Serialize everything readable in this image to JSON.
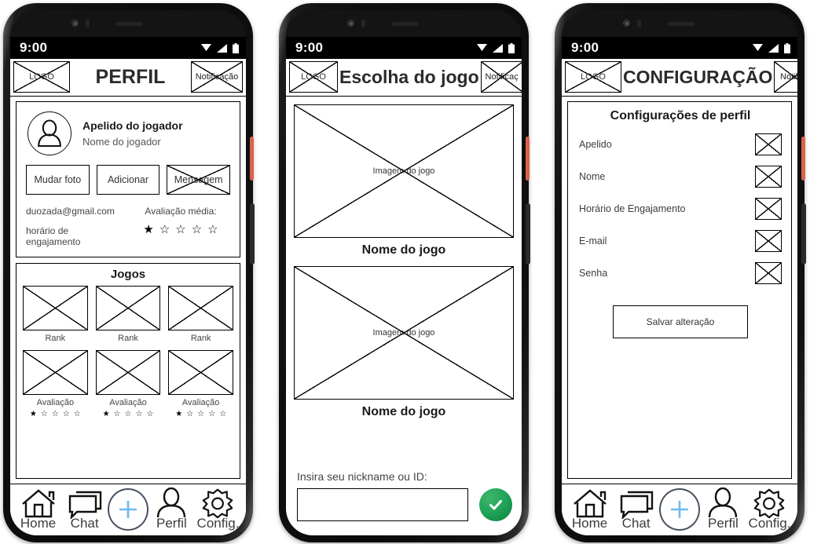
{
  "status_bar": {
    "time": "9:00",
    "icons": [
      "wifi-icon",
      "signal-icon",
      "battery-icon"
    ]
  },
  "nav": {
    "items": [
      {
        "label": "Home",
        "icon": "home-icon"
      },
      {
        "label": "Chat",
        "icon": "chat-icon"
      },
      {
        "label": "Perfil",
        "icon": "person-icon"
      },
      {
        "label": "Config.",
        "icon": "gear-icon"
      }
    ],
    "fab": {
      "icon": "plus-icon",
      "color": "#6db9f0"
    }
  },
  "phone1": {
    "header": {
      "logo": "LOGO",
      "title": "PERFIL",
      "notification": "Notificação"
    },
    "profile": {
      "avatar_icon": "user-avatar-icon",
      "nickname": "Apelido do jogador",
      "name": "Nome do jogador",
      "buttons": [
        "Mudar foto",
        "Adicionar",
        "Mensagem"
      ],
      "email": "duozada@gmail.com",
      "engagement": "horário de engajamento",
      "rating_label": "Avaliação média:",
      "rating_value": 1,
      "rating_max": 5
    },
    "games": {
      "title": "Jogos",
      "row1": [
        {
          "label": "Rank"
        },
        {
          "label": "Rank"
        },
        {
          "label": "Rank"
        }
      ],
      "row2": [
        {
          "label": "Avaliação",
          "rating_value": 1,
          "rating_max": 5
        },
        {
          "label": "Avaliação",
          "rating_value": 1,
          "rating_max": 5
        },
        {
          "label": "Avaliação",
          "rating_value": 1,
          "rating_max": 5
        }
      ]
    }
  },
  "phone2": {
    "header": {
      "logo": "LOGO",
      "title": "Escolha do jogo",
      "notification": "Notificaç"
    },
    "games": [
      {
        "image_label": "Imagem do jogo",
        "name": "Nome do jogo"
      },
      {
        "image_label": "Imagem do jogo",
        "name": "Nome do jogo"
      }
    ],
    "nickname_prompt": {
      "label": "Insira seu nickname ou ID:",
      "value": "",
      "placeholder": ""
    },
    "confirm_button": {
      "icon": "check-icon",
      "color": "#19a054"
    }
  },
  "phone3": {
    "header": {
      "logo": "LOGO",
      "title": "CONFIGURAÇÃO",
      "notification": "Notifica"
    },
    "settings": {
      "title": "Configurações de perfil",
      "rows": [
        {
          "label": "Apelido"
        },
        {
          "label": "Nome"
        },
        {
          "label": "Horário de Engajamento"
        },
        {
          "label": "E-mail"
        },
        {
          "label": "Senha"
        }
      ],
      "save_label": "Salvar alteração"
    }
  }
}
